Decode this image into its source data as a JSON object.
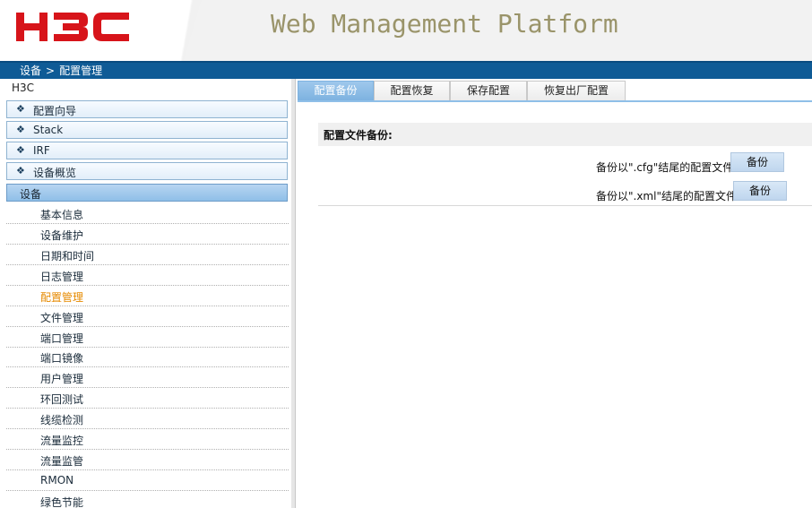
{
  "header": {
    "logo_text": "H3C",
    "title": "Web Management Platform"
  },
  "breadcrumb": [
    "设备",
    "配置管理"
  ],
  "breadcrumb_separator": ">",
  "sidebar": {
    "root": "H3C",
    "groups": [
      {
        "label": "配置向导"
      },
      {
        "label": "Stack"
      },
      {
        "label": "IRF"
      },
      {
        "label": "设备概览"
      },
      {
        "label": "设备"
      }
    ],
    "items": [
      {
        "label": "基本信息"
      },
      {
        "label": "设备维护"
      },
      {
        "label": "日期和时间"
      },
      {
        "label": "日志管理"
      },
      {
        "label": "配置管理"
      },
      {
        "label": "文件管理"
      },
      {
        "label": "端口管理"
      },
      {
        "label": "端口镜像"
      },
      {
        "label": "用户管理"
      },
      {
        "label": "环回测试"
      },
      {
        "label": "线缆检测"
      },
      {
        "label": "流量监控"
      },
      {
        "label": "流量监管"
      },
      {
        "label": "RMON"
      },
      {
        "label": "绿色节能"
      }
    ]
  },
  "tabs": [
    {
      "label": "配置备份"
    },
    {
      "label": "配置恢复"
    },
    {
      "label": "保存配置"
    },
    {
      "label": "恢复出厂配置"
    }
  ],
  "backup": {
    "section_title": "配置文件备份:",
    "rows": [
      {
        "label": "备份以\".cfg\"结尾的配置文件",
        "button": "备份"
      },
      {
        "label": "备份以\".xml\"结尾的配置文件",
        "button": "备份"
      }
    ]
  },
  "colors": {
    "brand_red": "#d7141a",
    "nav_blue": "#0f5b96",
    "tab_active": "#7db2e0",
    "current_item": "#e68a00"
  }
}
